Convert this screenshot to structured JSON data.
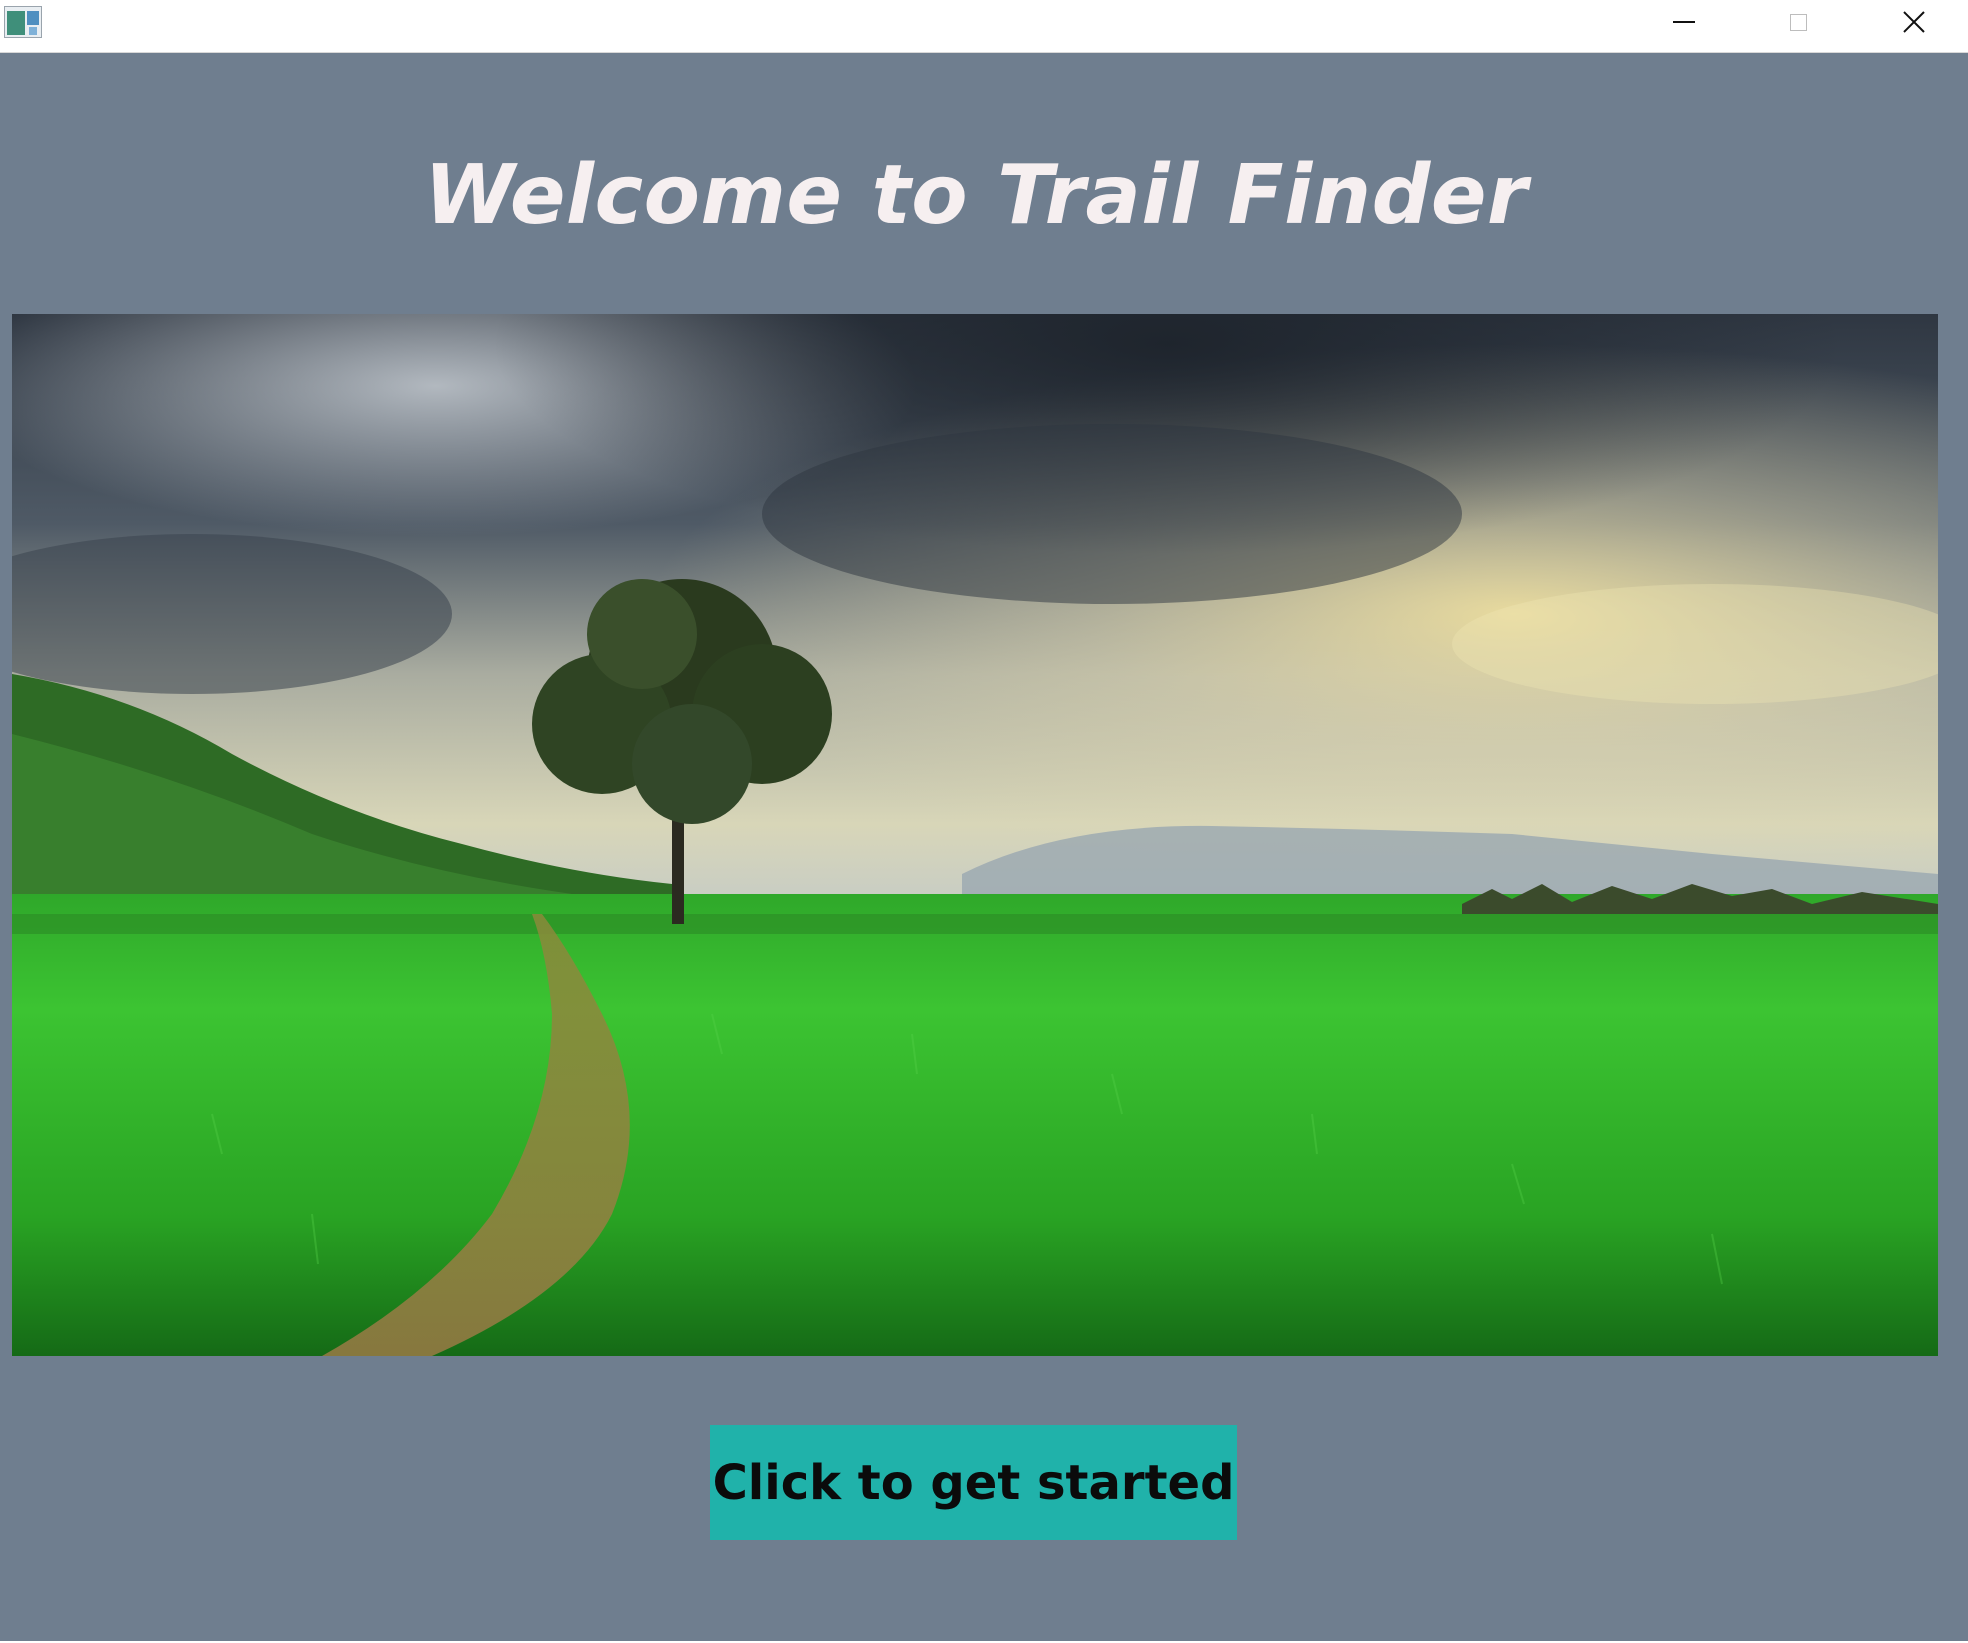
{
  "window": {
    "controls": {
      "minimize_icon": "minimize-icon",
      "maximize_icon": "maximize-icon",
      "close_icon": "close-icon"
    }
  },
  "main": {
    "title": "Welcome to Trail Finder",
    "start_button_label": "Click to get started"
  },
  "colors": {
    "background": "#6f7e8f",
    "title_text": "#f6eff0",
    "button_bg": "#20b2aa",
    "button_text": "#0b0b0b"
  }
}
